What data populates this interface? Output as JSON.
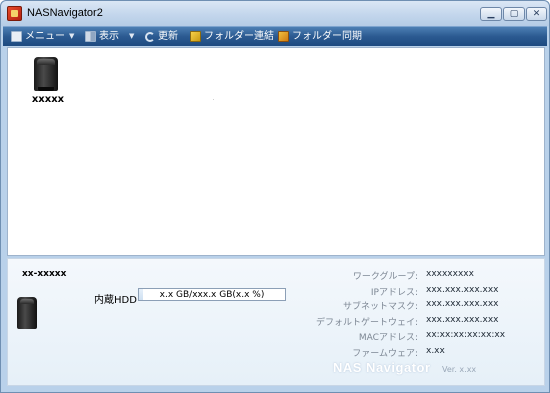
{
  "window": {
    "title": "NASNavigator2",
    "min_glyph": "▁",
    "max_glyph": "▢",
    "close_glyph": "✕"
  },
  "menubar": {
    "menu_label": "メニュー",
    "view_label": "表示",
    "refresh_label": "更新",
    "folder_link_label": "フォルダー連結",
    "folder_sync_label": "フォルダー同期"
  },
  "devices": [
    {
      "label": "xxxxx",
      "icon": "nas-drive-icon"
    }
  ],
  "detail": {
    "name": "xx-xxxxx",
    "hdd_label": "内蔵HDD",
    "hdd_usage": "x.x GB/xxx.x GB(x.x %)",
    "info": [
      {
        "label": "ワークグループ:",
        "value": "xxxxxxxxx"
      },
      {
        "label": "IPアドレス:",
        "value": "xxx.xxx.xxx.xxx"
      },
      {
        "label": "サブネットマスク:",
        "value": "xxx.xxx.xxx.xxx"
      },
      {
        "label": "デフォルトゲートウェイ:",
        "value": "xxx.xxx.xxx.xxx"
      },
      {
        "label": "MACアドレス:",
        "value": "xx:xx:xx:xx:xx:xx"
      },
      {
        "label": "ファームウェア:",
        "value": "x.xx"
      }
    ],
    "brand": "NAS Navigator",
    "version": "Ver. x.xx"
  },
  "colors": {
    "menubar": "#2b5a91",
    "panel_bg": "#e6f0f8",
    "title_bar": "#c3d6ec"
  }
}
